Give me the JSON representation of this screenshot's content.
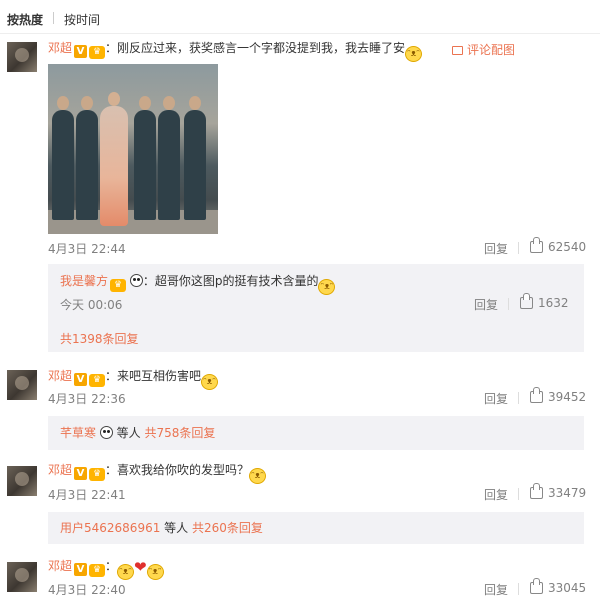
{
  "tabs": {
    "hot": "按热度",
    "time": "按时间"
  },
  "comments": [
    {
      "user": "邓超",
      "text": "：刚反应过来，获奖感言一个字都没提到我，我去睡了安",
      "comment_pic": "评论配图",
      "time": "4月3日 22:44",
      "reply": "回复",
      "likes": "62540",
      "sub": {
        "user": "我是馨方",
        "text": "：超哥你这图p的挺有技术含量的",
        "time": "今天 00:06",
        "reply": "回复",
        "likes": "1632"
      },
      "more": "共1398条回复"
    },
    {
      "user": "邓超",
      "text": "：来吧互相伤害吧",
      "time": "4月3日 22:36",
      "reply": "回复",
      "likes": "39452",
      "summary_user": "芊草寒",
      "summary_mid": " 等人 ",
      "summary_more": "共758条回复"
    },
    {
      "user": "邓超",
      "text": "：喜欢我给你吹的发型吗？",
      "time": "4月3日 22:41",
      "reply": "回复",
      "likes": "33479",
      "summary_user": "用户5462686961",
      "summary_mid": " 等人 ",
      "summary_more": "共260条回复"
    },
    {
      "user": "邓超",
      "text": "：",
      "time": "4月3日 22:40",
      "reply": "回复",
      "likes": "33045"
    }
  ],
  "icons": {
    "verified": "verified-v-icon",
    "crown": "vip-crown-icon",
    "thumb": "thumbs-up-icon",
    "panda": "panda-emoji-icon",
    "cat": "cat-emoji-icon",
    "heart": "heart-emoji-icon"
  },
  "colors": {
    "accent": "#eb7350",
    "meta": "#808080",
    "subbox": "#f2f2f5"
  }
}
